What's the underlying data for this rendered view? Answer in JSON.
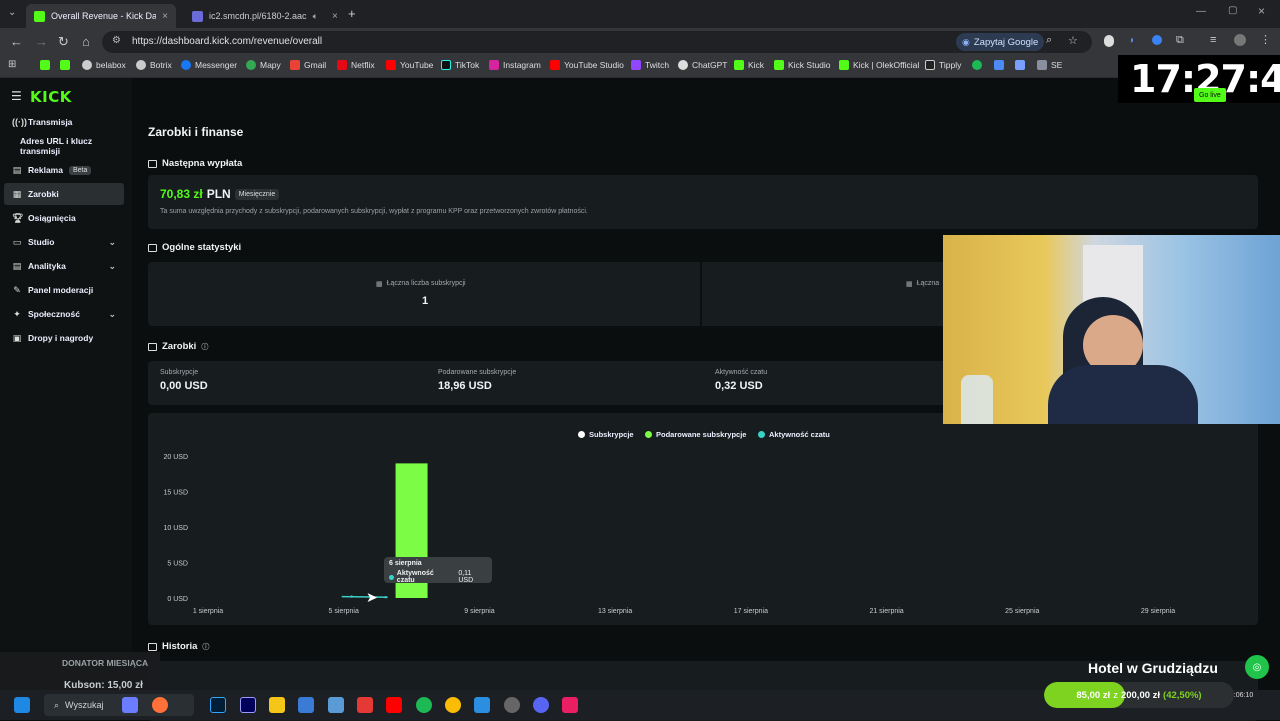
{
  "browser": {
    "tabs": [
      {
        "label": "Overall Revenue - Kick Dashboa",
        "active": true
      },
      {
        "label": "ic2.smcdn.pl/6180-2.aac",
        "active": false
      }
    ],
    "url": "https://dashboard.kick.com/revenue/overall",
    "google_button": "Zapytaj Google",
    "bookmarks": [
      "belabox",
      "Botrix",
      "Messenger",
      "Mapy",
      "Gmail",
      "Netflix",
      "YouTube",
      "TikTok",
      "Instagram",
      "YouTube Studio",
      "Twitch",
      "ChatGPT",
      "Kick",
      "Kick Studio",
      "Kick | OlekOfficial",
      "Tipply",
      "SE"
    ]
  },
  "sidebar": {
    "logo": "KICK",
    "items": [
      {
        "label": "Transmisja",
        "icon": "broadcast-icon",
        "active": false,
        "chevron": false
      },
      {
        "label": "Adres URL i klucz transmisji",
        "icon": "",
        "active": false,
        "chevron": false,
        "sub": true
      },
      {
        "label": "Reklama",
        "icon": "ad-icon",
        "active": false,
        "chevron": false,
        "badge": "Beta"
      },
      {
        "label": "Zarobki",
        "icon": "earnings-icon",
        "active": true,
        "chevron": false
      },
      {
        "label": "Osiągnięcia",
        "icon": "trophy-icon",
        "active": false,
        "chevron": false
      },
      {
        "label": "Studio",
        "icon": "studio-icon",
        "active": false,
        "chevron": true
      },
      {
        "label": "Analityka",
        "icon": "analytics-icon",
        "active": false,
        "chevron": true
      },
      {
        "label": "Panel moderacji",
        "icon": "wrench-icon",
        "active": false,
        "chevron": false
      },
      {
        "label": "Społeczność",
        "icon": "community-icon",
        "active": false,
        "chevron": true
      },
      {
        "label": "Dropy i nagrody",
        "icon": "gift-icon",
        "active": false,
        "chevron": false
      }
    ]
  },
  "page": {
    "title": "Zarobki i finanse",
    "next_payout": {
      "heading": "Następna wypłata",
      "amount": "70,83 zł",
      "currency": "PLN",
      "badge": "Miesięcznie",
      "note": "Ta suma uwzględnia przychody z subskrypcji, podarowanych subskrypcji, wypłat z programu KPP oraz przetworzonych zwrotów płatności."
    },
    "general_stats": {
      "heading": "Ogólne statystyki",
      "total_subs_label": "Łączna liczba subskrypcji",
      "total_subs_value": "1",
      "second_label": "Łączna"
    },
    "earnings": {
      "heading": "Zarobki",
      "stats": [
        {
          "label": "Subskrypcje",
          "value": "0,00 USD"
        },
        {
          "label": "Podarowane subskrypcje",
          "value": "18,96 USD"
        },
        {
          "label": "Aktywność czatu",
          "value": "0,32 USD"
        }
      ]
    },
    "history_heading": "Historia"
  },
  "chart_data": {
    "type": "bar",
    "x_ticks": [
      "1 sierpnia",
      "5 sierpnia",
      "9 sierpnia",
      "13 sierpnia",
      "17 sierpnia",
      "21 sierpnia",
      "25 sierpnia",
      "29 sierpnia"
    ],
    "y_ticks": [
      "0 USD",
      "5 USD",
      "10 USD",
      "15 USD",
      "20 USD"
    ],
    "ylim": [
      0,
      20
    ],
    "series": [
      {
        "name": "Subskrypcje",
        "color": "#ffffff",
        "points": []
      },
      {
        "name": "Podarowane subskrypcje",
        "color": "#7cfc44",
        "points": [
          {
            "day": 7,
            "value": 18.96
          }
        ]
      },
      {
        "name": "Aktywność czatu",
        "color": "#3ad1c8",
        "points": [
          {
            "day": 5,
            "value": 0.2
          },
          {
            "day": 6,
            "value": 0.11
          }
        ]
      }
    ],
    "tooltip": {
      "date": "6 sierpnia",
      "series": "Aktywność czatu",
      "value": "0,11 USD"
    }
  },
  "overlays": {
    "clock": "17:27:41",
    "go_live": "Go live",
    "donator_title": "DONATOR MIESIĄCA",
    "donator_value": "Kubson: 15,00 zł",
    "goal_title": "Hotel w Grudziądzu",
    "goal_current": "85,00 zł",
    "goal_sep": "z",
    "goal_target": "200,00 zł",
    "goal_percent": "(42,50%)",
    "goal_fraction": 0.425
  },
  "taskbar": {
    "search_placeholder": "Wyszukaj",
    "time": "17:06:10"
  }
}
